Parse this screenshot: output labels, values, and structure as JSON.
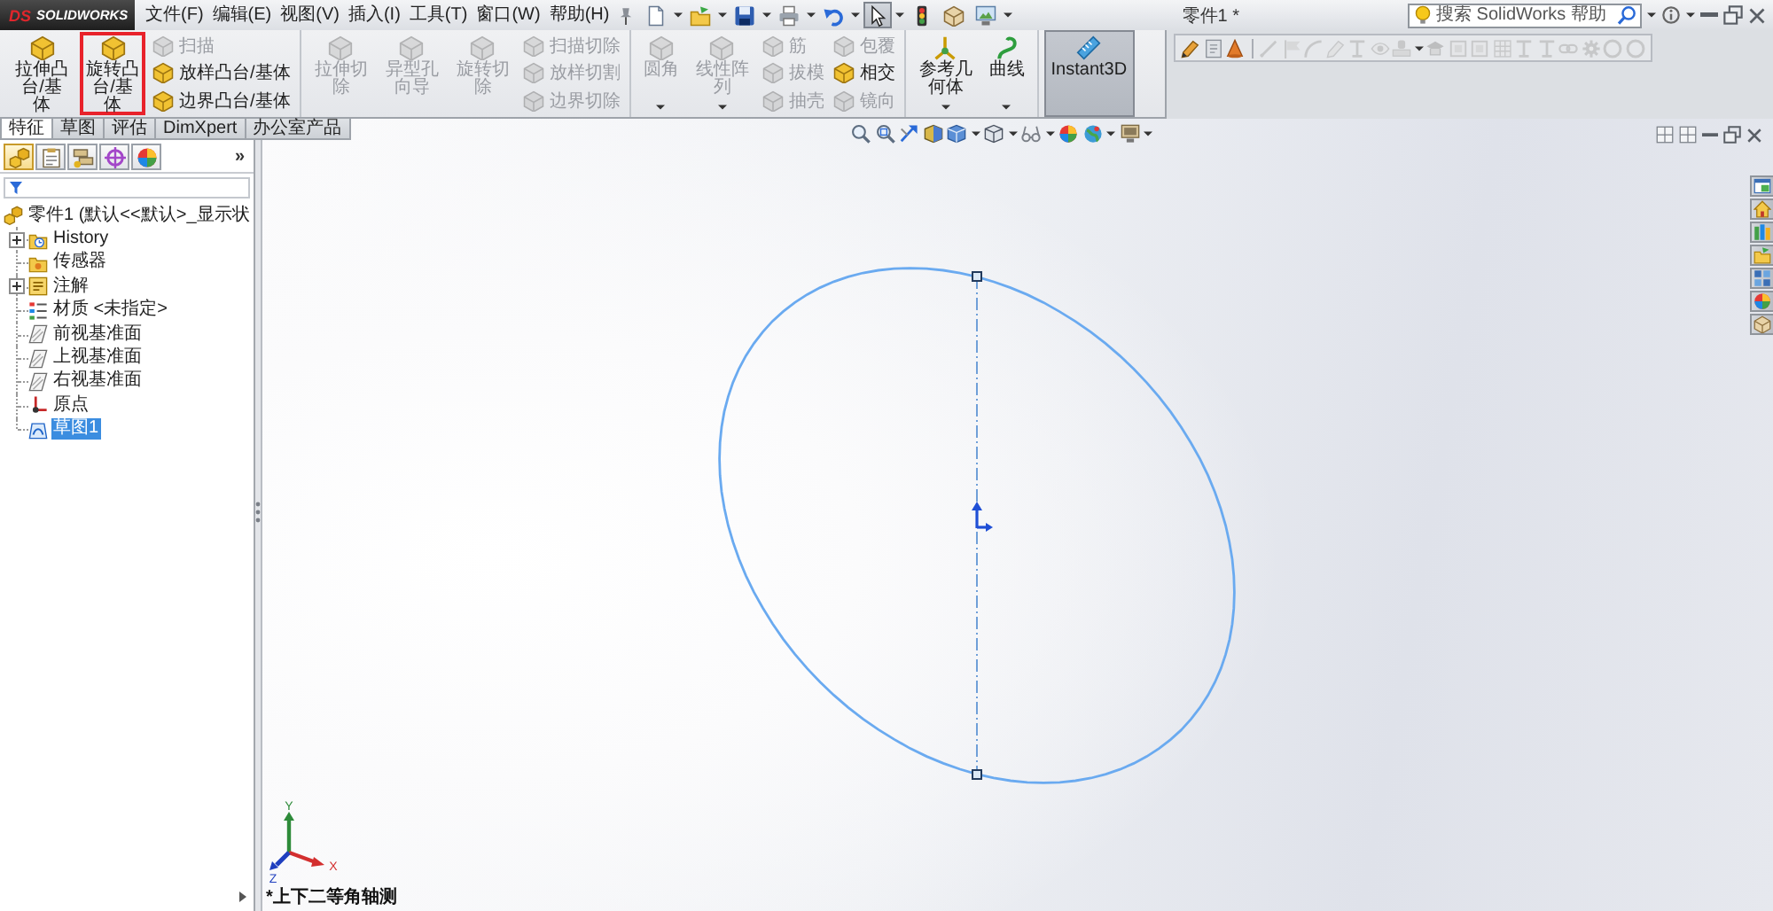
{
  "menu_bar": {
    "logo": {
      "mark": "DS",
      "name": "SOLIDWORKS"
    },
    "menus": [
      "文件(F)",
      "编辑(E)",
      "视图(V)",
      "插入(I)",
      "工具(T)",
      "窗口(W)",
      "帮助(H)"
    ],
    "quick_toolbar": [
      {
        "kind": "new",
        "dropdown": true,
        "selected": false
      },
      {
        "kind": "open",
        "dropdown": true,
        "selected": false
      },
      {
        "kind": "save",
        "dropdown": true,
        "selected": false
      },
      {
        "kind": "print",
        "dropdown": true,
        "selected": false
      },
      {
        "kind": "undo",
        "dropdown": true,
        "selected": false
      },
      {
        "kind": "select",
        "dropdown": true,
        "selected": true
      },
      {
        "kind": "rebuild",
        "dropdown": false,
        "selected": false
      },
      {
        "kind": "options",
        "dropdown": false,
        "selected": false
      },
      {
        "kind": "screen",
        "dropdown": true,
        "selected": false
      }
    ],
    "document_title": "零件1 *",
    "search": {
      "placeholder": "搜索 SolidWorks 帮助"
    }
  },
  "command_manager": {
    "groups": [
      [
        {
          "kind": "large",
          "label": "拉伸凸台/基体",
          "disabled": false,
          "dropdown": false,
          "on": false,
          "highlighted": false
        },
        {
          "kind": "large",
          "label": "旋转凸台/基体",
          "disabled": false,
          "dropdown": false,
          "on": false,
          "highlighted": true
        },
        {
          "kind": "small",
          "buttons": [
            {
              "label": "扫描",
              "disabled": true
            },
            {
              "label": "放样凸台/基体",
              "disabled": false
            },
            {
              "label": "边界凸台/基体",
              "disabled": false
            }
          ]
        }
      ],
      [
        {
          "kind": "large",
          "label": "拉伸切除",
          "disabled": true,
          "dropdown": false,
          "on": false,
          "highlighted": false
        },
        {
          "kind": "large",
          "label": "异型孔向导",
          "disabled": true,
          "dropdown": false,
          "on": false,
          "highlighted": false
        },
        {
          "kind": "large",
          "label": "旋转切除",
          "disabled": true,
          "dropdown": false,
          "on": false,
          "highlighted": false
        },
        {
          "kind": "small",
          "buttons": [
            {
              "label": "扫描切除",
              "disabled": true
            },
            {
              "label": "放样切割",
              "disabled": true
            },
            {
              "label": "边界切除",
              "disabled": true
            }
          ]
        }
      ],
      [
        {
          "kind": "large",
          "label": "圆角",
          "disabled": true,
          "dropdown": true,
          "on": false,
          "highlighted": false
        },
        {
          "kind": "large",
          "label": "线性阵列",
          "disabled": true,
          "dropdown": true,
          "on": false,
          "highlighted": false
        },
        {
          "kind": "small",
          "buttons": [
            {
              "label": "筋",
              "disabled": true
            },
            {
              "label": "拔模",
              "disabled": true
            },
            {
              "label": "抽壳",
              "disabled": true
            }
          ]
        },
        {
          "kind": "small",
          "buttons": [
            {
              "label": "包覆",
              "disabled": true
            },
            {
              "label": "相交",
              "disabled": false
            },
            {
              "label": "镜向",
              "disabled": true
            }
          ]
        }
      ],
      [
        {
          "kind": "large",
          "label": "参考几何体",
          "disabled": false,
          "dropdown": true,
          "on": false,
          "highlighted": false
        },
        {
          "kind": "large",
          "label": "曲线",
          "disabled": false,
          "dropdown": true,
          "on": false,
          "highlighted": false
        }
      ],
      [
        {
          "kind": "large",
          "label": "Instant3D",
          "disabled": false,
          "dropdown": false,
          "on": true,
          "highlighted": false
        }
      ]
    ],
    "tabs": [
      {
        "label": "特征",
        "selected": true
      },
      {
        "label": "草图",
        "selected": false
      },
      {
        "label": "评估",
        "selected": false
      },
      {
        "label": "DimXpert",
        "selected": false
      },
      {
        "label": "办公室产品",
        "selected": false
      }
    ]
  },
  "feature_manager": {
    "panel_tabs": [
      {
        "kind": "tree",
        "selected": true
      },
      {
        "kind": "property",
        "selected": false
      },
      {
        "kind": "config",
        "selected": false
      },
      {
        "kind": "dimxpert",
        "selected": false
      },
      {
        "kind": "display",
        "selected": false
      }
    ],
    "more": "»",
    "tree": {
      "label": "零件1 (默认<<默认>_显示状",
      "kind": "part",
      "children": [
        {
          "label": "History",
          "kind": "history",
          "collapsed": true,
          "selected": false
        },
        {
          "label": "传感器",
          "kind": "sensor",
          "collapsed": false,
          "selected": false
        },
        {
          "label": "注解",
          "kind": "annotation",
          "collapsed": true,
          "selected": false
        },
        {
          "label": "材质 <未指定>",
          "kind": "material",
          "collapsed": false,
          "selected": false
        },
        {
          "label": "前视基准面",
          "kind": "plane",
          "collapsed": false,
          "selected": false
        },
        {
          "label": "上视基准面",
          "kind": "plane",
          "collapsed": false,
          "selected": false
        },
        {
          "label": "右视基准面",
          "kind": "plane",
          "collapsed": false,
          "selected": false
        },
        {
          "label": "原点",
          "kind": "origin",
          "collapsed": false,
          "selected": false
        },
        {
          "label": "草图1",
          "kind": "sketch",
          "collapsed": false,
          "selected": true
        }
      ]
    }
  },
  "graphics": {
    "view_label": "*上下二等角轴测",
    "triad": {
      "x": "X",
      "y": "Y",
      "z": "Z"
    }
  }
}
